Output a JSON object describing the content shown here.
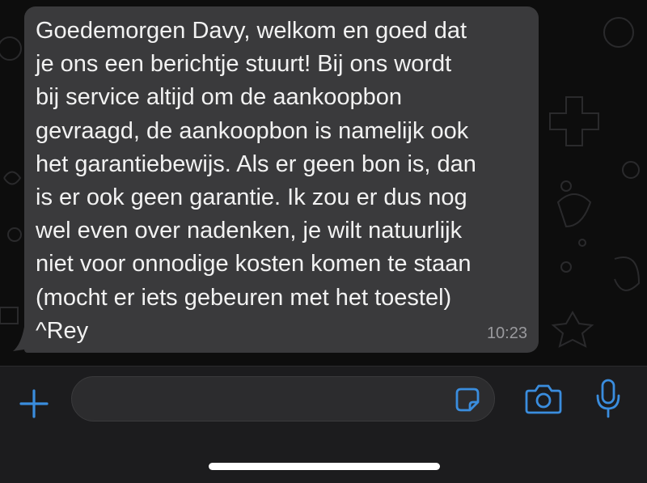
{
  "message": {
    "text": "Goedemorgen Davy, welkom en goed dat\nje ons een berichtje stuurt! Bij ons wordt\nbij service altijd om de aankoopbon\ngevraagd, de aankoopbon is namelijk ook\nhet garantiebewijs. Als er geen bon is, dan\nis er ook geen garantie. Ik zou er dus nog\nwel even over nadenken, je wilt natuurlijk\nniet voor onnodige kosten komen te staan\n(mocht er iets gebeuren met het toestel)\n^Rey",
    "time": "10:23"
  },
  "composer": {
    "input_value": "",
    "input_placeholder": "",
    "plus_icon": "plus-icon",
    "sticker_icon": "sticker-icon",
    "camera_icon": "camera-icon",
    "mic_icon": "microphone-icon"
  },
  "colors": {
    "bubble": "#3a3a3c",
    "accent": "#3a8dde",
    "text": "#f2f2f2",
    "timestamp": "#9a9a9e",
    "composer_bg": "#1c1c1e"
  }
}
